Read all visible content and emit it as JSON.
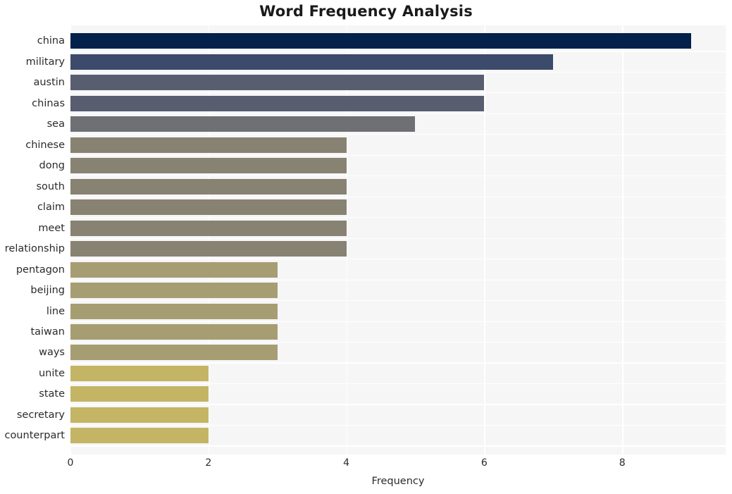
{
  "chart_data": {
    "type": "bar",
    "orientation": "horizontal",
    "title": "Word Frequency Analysis",
    "xlabel": "Frequency",
    "ylabel": "",
    "categories": [
      "china",
      "military",
      "austin",
      "chinas",
      "sea",
      "chinese",
      "dong",
      "south",
      "claim",
      "meet",
      "relationship",
      "pentagon",
      "beijing",
      "line",
      "taiwan",
      "ways",
      "unite",
      "state",
      "secretary",
      "counterpart"
    ],
    "values": [
      9,
      7,
      6,
      6,
      5,
      4,
      4,
      4,
      4,
      4,
      4,
      3,
      3,
      3,
      3,
      3,
      2,
      2,
      2,
      2
    ],
    "bar_colors": [
      "#03214a",
      "#3c4a6b",
      "#585d70",
      "#585d70",
      "#6e7073",
      "#888273",
      "#888273",
      "#888273",
      "#888273",
      "#888273",
      "#888273",
      "#a69d72",
      "#a69d72",
      "#a69d72",
      "#a69d72",
      "#a69d72",
      "#c4b565",
      "#c4b565",
      "#c4b565",
      "#c4b565"
    ],
    "xticks": [
      0,
      2,
      4,
      6,
      8
    ],
    "xtick_labels": [
      "0",
      "2",
      "4",
      "6",
      "8"
    ],
    "xlim": [
      0,
      9.5
    ],
    "grid": true,
    "grid_color": "#ffffff",
    "plot_background": "#f6f6f7",
    "figure_background": "#ffffff",
    "legend": null
  }
}
